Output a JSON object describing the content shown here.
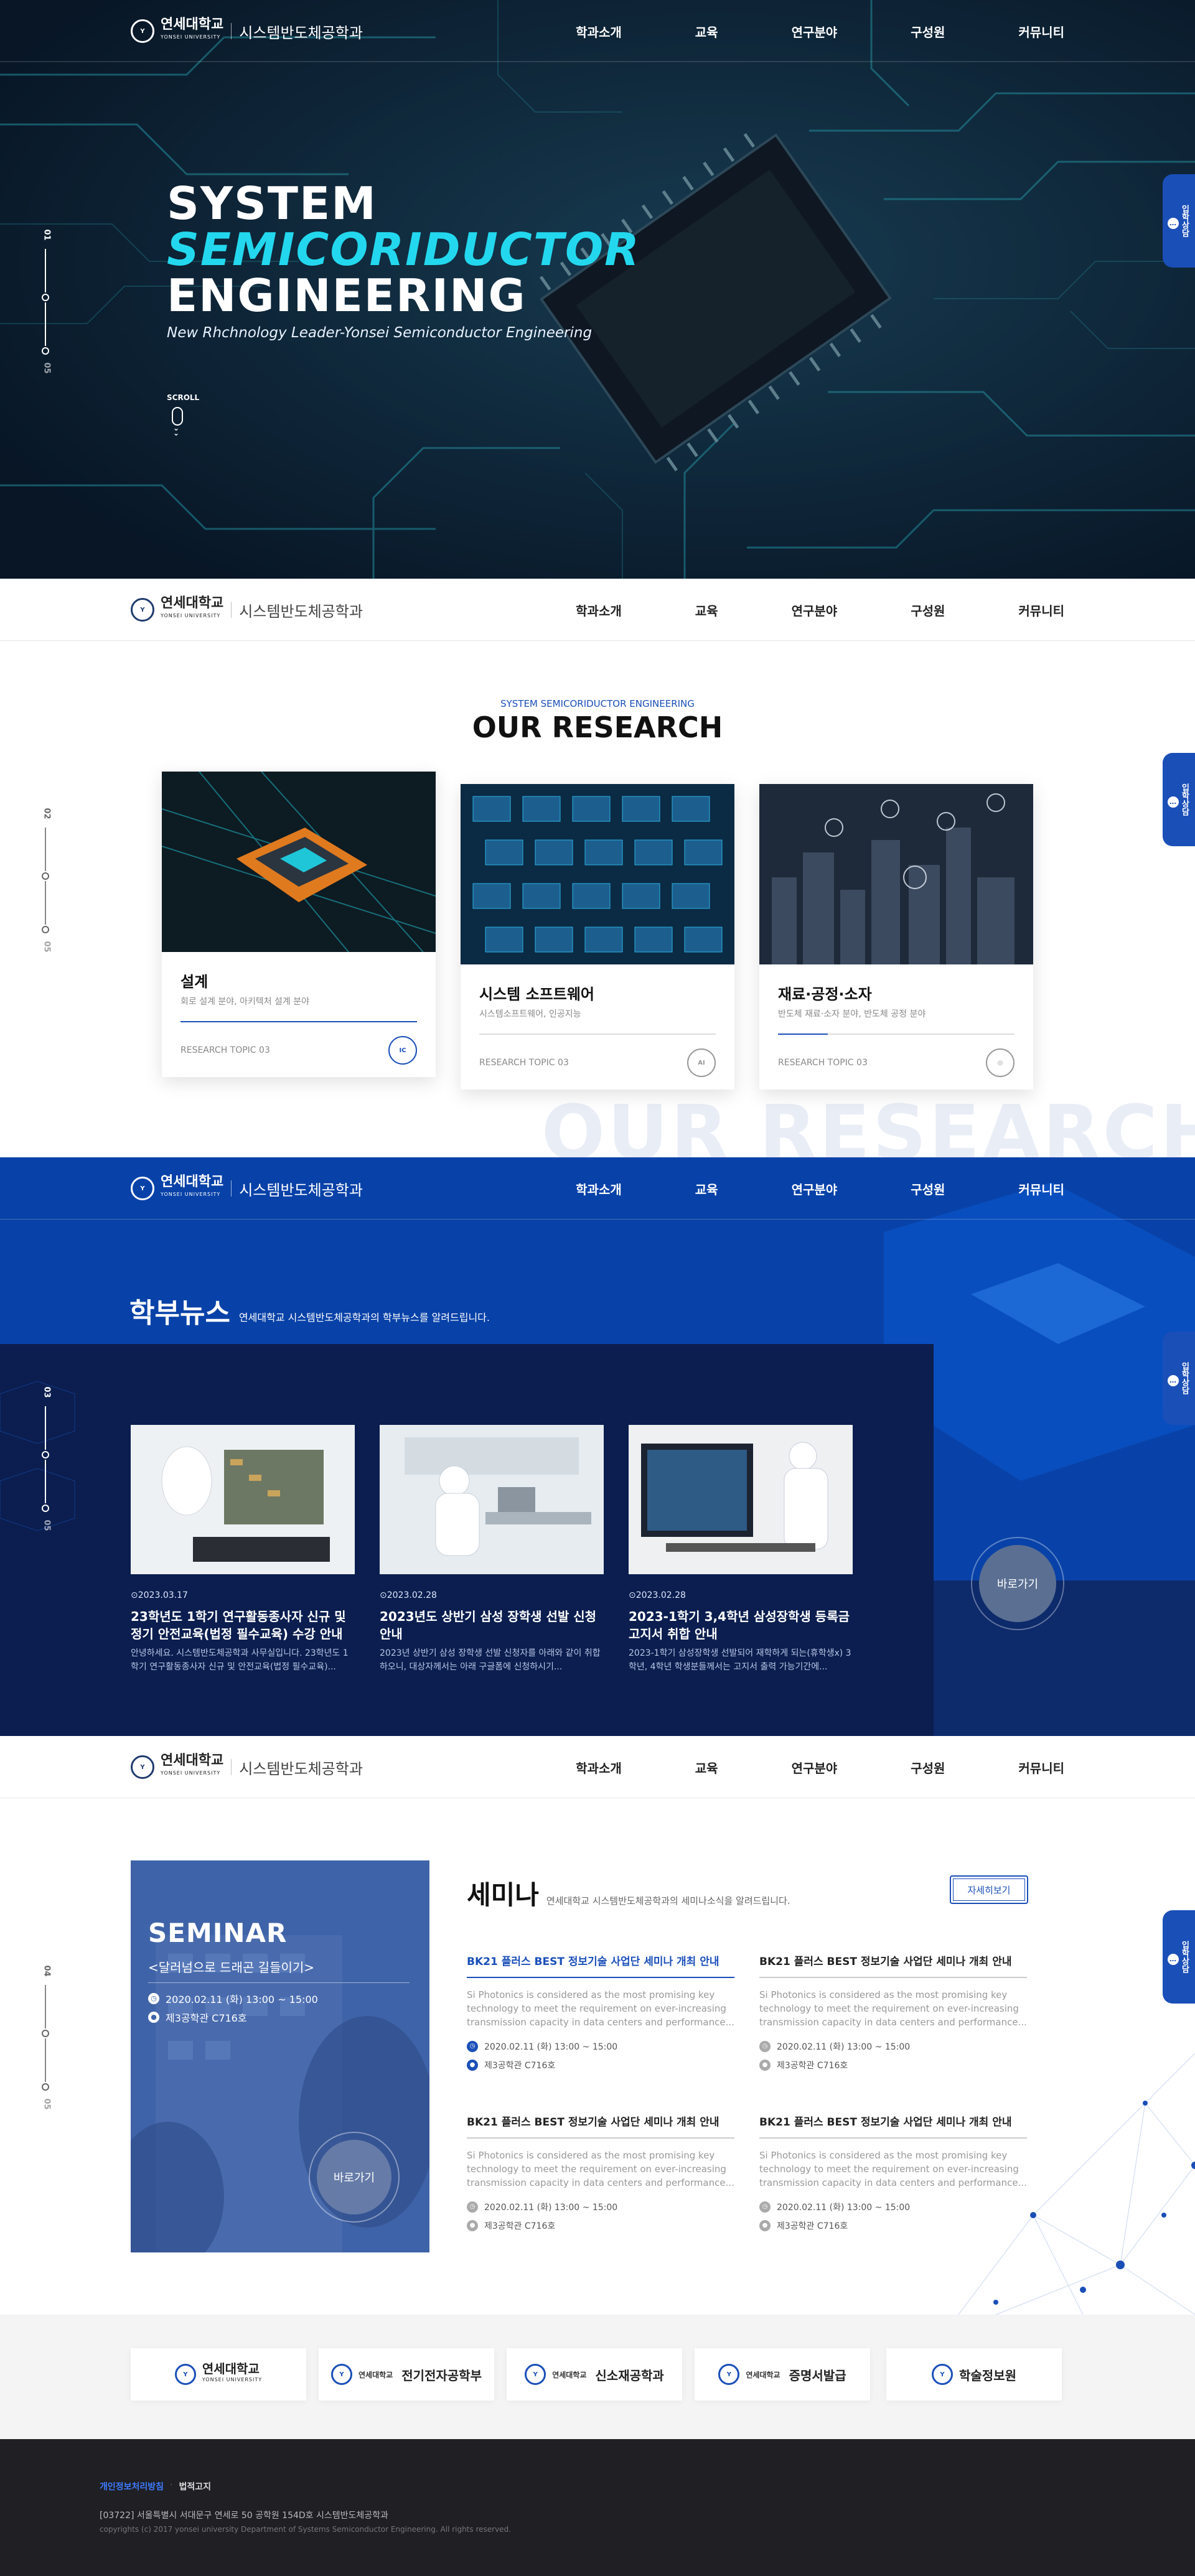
{
  "brand": {
    "univ": "연세대학교",
    "univ_en": "YONSEI UNIVERSITY",
    "dept": "시스템반도체공학과"
  },
  "nav": [
    "학과소개",
    "교육",
    "연구분야",
    "구성원",
    "커뮤니티"
  ],
  "side_button": {
    "label": "입학상담",
    "icon": "chat-icon"
  },
  "hero": {
    "line1": "SYSTEM",
    "line2": "SEMICORIDUCTOR",
    "line3": "ENGINEERING",
    "subtitle": "New Rhchnology Leader-Yonsei Semiconductor Engineering",
    "scroll": "SCROLL",
    "page_current": "01",
    "page_total": "05"
  },
  "research": {
    "eyebrow": "SYSTEM SEMICORIDUCTOR ENGINEERING",
    "title": "OUR RESEARCH",
    "watermark": "OUR RESEARCH",
    "page_current": "02",
    "page_total": "05",
    "cards": [
      {
        "title": "설계",
        "desc": "회로 설계 분야, 아키텍처 설계 분야",
        "topic": "RESEARCH TOPIC 03",
        "icon": "chip-icon"
      },
      {
        "title": "시스템 소프트웨어",
        "desc": "시스템소프트웨어, 인공지능",
        "topic": "RESEARCH TOPIC 03",
        "icon": "brain-icon"
      },
      {
        "title": "재료·공정·소자",
        "desc": "반도체 재료·소자 분야, 반도체 공정 분야",
        "topic": "RESEARCH TOPIC 03",
        "icon": "atom-icon"
      }
    ]
  },
  "news": {
    "title": "학부뉴스",
    "desc": "연세대학교 시스템반도체공학과의 학부뉴스를 알려드립니다.",
    "more": "바로가기",
    "page_current": "03",
    "page_total": "05",
    "items": [
      {
        "date": "2023.03.17",
        "title": "23학년도 1학기 연구활동종사자 신규 및 정기 안전교육(법정 필수교육) 수강 안내",
        "desc": "안녕하세요. 시스템반도체공학과 사무실입니다. 23학년도 1학기 연구활동종사자 신규 및 안전교육(법정 필수교육)..."
      },
      {
        "date": "2023.02.28",
        "title": "2023년도 상반기 삼성 장학생 선발 신청 안내",
        "desc": "2023년 상반기 삼성 장학생 선발 신청자를 아래와 같이 취합하오니, 대상자께서는 아래 구글폼에 신청하시기..."
      },
      {
        "date": "2023.02.28",
        "title": "2023-1학기 3,4학년 삼성장학생 등록금 고지서 취합 안내",
        "desc": "2023-1학기 삼성장학생 선발되어 재학하게 되는(휴학생x) 3학년, 4학년 학생분들께서는 고지서 출력 가능기간에..."
      }
    ]
  },
  "seminar": {
    "card_title": "SEMINAR",
    "card_sub": "<달러넘으로 드래곤 길들이기>",
    "card_time": "2020.02.11 (화) 13:00 ~ 15:00",
    "card_place": "제3공학관 C716호",
    "card_btn": "바로가기",
    "title": "세미나",
    "desc": "연세대학교 시스템반도체공학과의 세미나소식을 알려드립니다.",
    "more": "자세히보기",
    "page_current": "04",
    "page_total": "05",
    "items": [
      {
        "title": "BK21 플러스 BEST 정보기술 사업단 세미나 개최 안내",
        "desc": "Si Photonics is considered as the most promising key technology to meet the requirement on ever-increasing transmission capacity in data centers and performance...",
        "time": "2020.02.11 (화) 13:00 ~ 15:00",
        "place": "제3공학관 C716호"
      },
      {
        "title": "BK21 플러스 BEST 정보기술 사업단 세미나 개최 안내",
        "desc": "Si Photonics is considered as the most promising key technology to meet the requirement on ever-increasing transmission capacity in data centers and performance...",
        "time": "2020.02.11 (화) 13:00 ~ 15:00",
        "place": "제3공학관 C716호"
      },
      {
        "title": "BK21 플러스 BEST 정보기술 사업단 세미나 개최 안내",
        "desc": "Si Photonics is considered as the most promising key technology to meet the requirement on ever-increasing transmission capacity in data centers and performance...",
        "time": "2020.02.11 (화) 13:00 ~ 15:00",
        "place": "제3공학관 C716호"
      },
      {
        "title": "BK21 플러스 BEST 정보기술 사업단 세미나 개최 안내",
        "desc": "Si Photonics is considered as the most promising key technology to meet the requirement on ever-increasing transmission capacity in data centers and performance...",
        "time": "2020.02.11 (화) 13:00 ~ 15:00",
        "place": "제3공학관 C716호"
      }
    ]
  },
  "partners": [
    {
      "name": "연세대학교",
      "sub": "YONSEI UNIVERSITY"
    },
    {
      "name": "전기전자공학부"
    },
    {
      "name": "신소재공학과"
    },
    {
      "name": "증명서발급"
    },
    {
      "name": "학술정보원"
    }
  ],
  "footer": {
    "privacy": "개인정보처리방침",
    "legal": "법적고지",
    "address": "[03722] 서울특별시 서대문구 연세로 50 공학원 154D호 시스템반도체공학과",
    "copyright": "copyrights (c) 2017 yonsei university Department of Systems Semiconductor Engineering. All rights reserved."
  },
  "colors": {
    "primary": "#1a4fb8",
    "accent": "#23d8ee",
    "navy": "#0b1e4f",
    "footer": "#1f1f24"
  }
}
